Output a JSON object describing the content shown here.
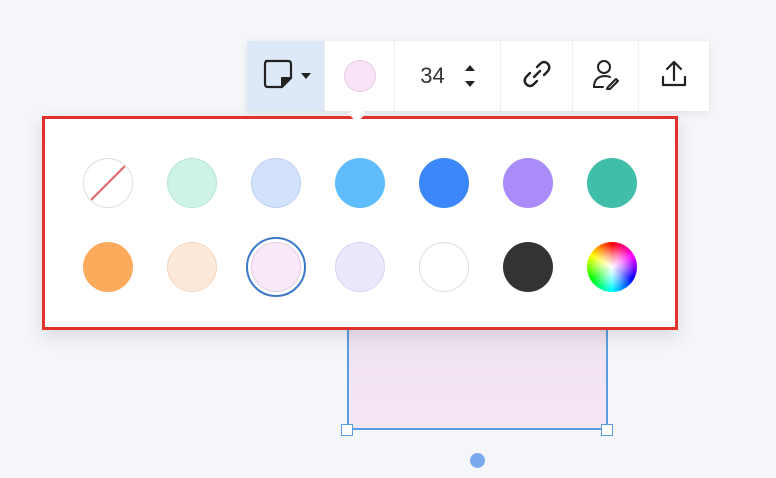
{
  "toolbar": {
    "shape_icon": "sticky-note-icon",
    "current_color": "#f9e3f7",
    "font_size": "34",
    "link_icon": "link-icon",
    "user_icon": "user-edit-icon",
    "upload_icon": "upload-icon"
  },
  "palette": {
    "selected_index": 9,
    "colors": [
      {
        "name": "none",
        "hex": "#ffffff"
      },
      {
        "name": "mint",
        "hex": "#ccf3e4"
      },
      {
        "name": "light-blue",
        "hex": "#d2e2fc"
      },
      {
        "name": "sky-blue",
        "hex": "#5fbdfd"
      },
      {
        "name": "blue",
        "hex": "#3b86f8"
      },
      {
        "name": "purple",
        "hex": "#a98cf8"
      },
      {
        "name": "teal",
        "hex": "#40bea9"
      },
      {
        "name": "orange",
        "hex": "#fcab5c"
      },
      {
        "name": "peach",
        "hex": "#fde9d9"
      },
      {
        "name": "light-pink",
        "hex": "#f9e8f8"
      },
      {
        "name": "lavender",
        "hex": "#ebe7fc"
      },
      {
        "name": "white",
        "hex": "#ffffff"
      },
      {
        "name": "black",
        "hex": "#333333"
      },
      {
        "name": "custom-spectrum",
        "hex": "conic"
      }
    ]
  },
  "canvas": {
    "note_color": "#f3e4f3",
    "selection_color": "#5b9ee0"
  }
}
